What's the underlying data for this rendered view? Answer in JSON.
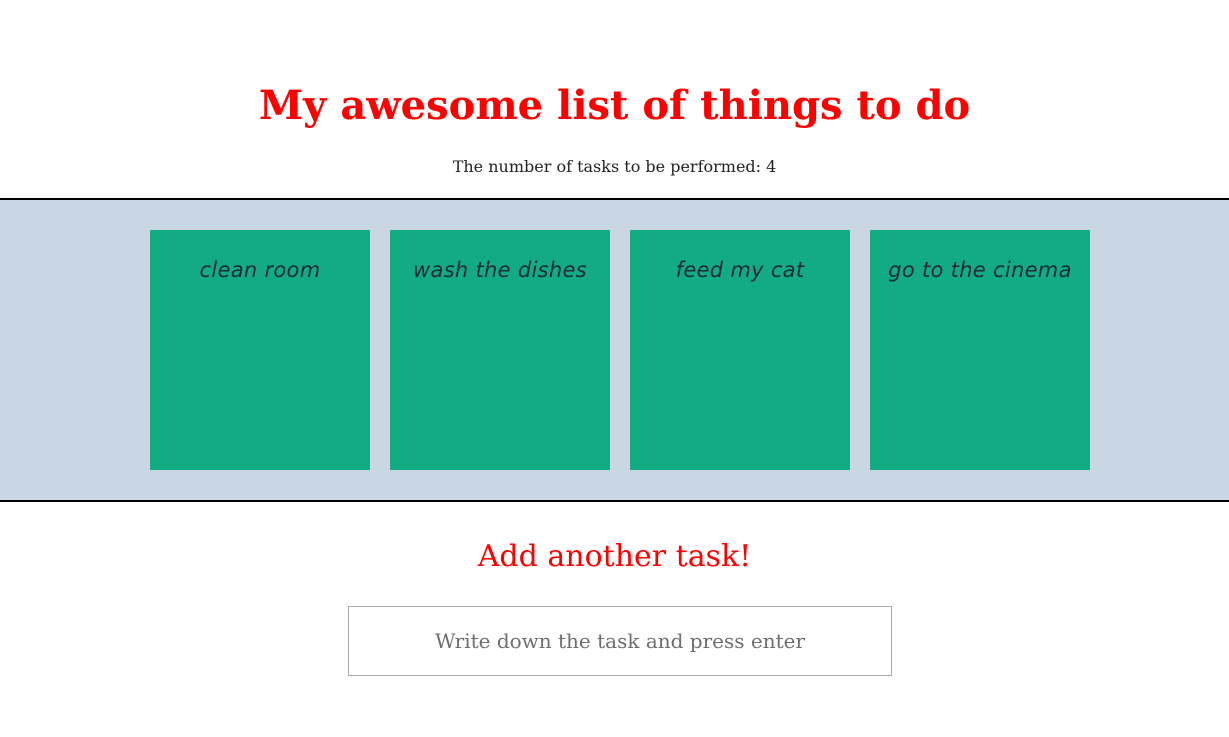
{
  "header": {
    "title": "My awesome list of things to do",
    "counter_label": "The number of tasks to be performed: 4",
    "title_color": "#ff0000"
  },
  "board": {
    "background_color": "#c9d6e4",
    "note_color": "#12ab84",
    "tasks": [
      {
        "label": "clean room"
      },
      {
        "label": "wash the dishes"
      },
      {
        "label": "feed my cat"
      },
      {
        "label": "go to the cinema"
      }
    ]
  },
  "add_task": {
    "heading": "Add another task!",
    "input_value": "",
    "input_placeholder": "Write down the task and press enter"
  }
}
